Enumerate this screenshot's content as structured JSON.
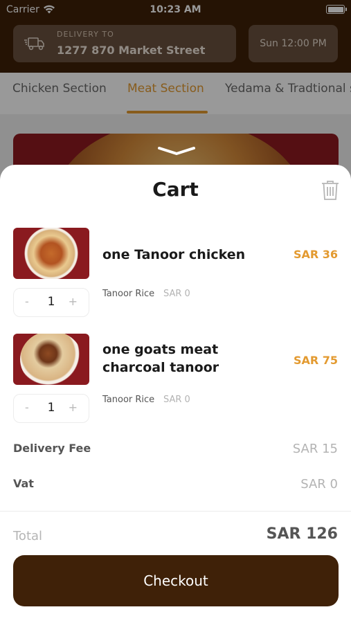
{
  "status_bar": {
    "carrier": "Carrier",
    "time": "10:23 AM"
  },
  "header": {
    "delivery_label": "DELIVERY TO",
    "delivery_address": "1277 870 Market Street",
    "delivery_time": "Sun 12:00 PM"
  },
  "tabs": [
    {
      "label": "Chicken Section",
      "active": false
    },
    {
      "label": "Meat Section",
      "active": true
    },
    {
      "label": "Yedama & Tradtional s",
      "active": false
    }
  ],
  "cart": {
    "title": "Cart",
    "items": [
      {
        "name": "one Tanoor chicken",
        "price": "SAR 36",
        "quantity": "1",
        "minus": "-",
        "plus": "+",
        "option_name": "Tanoor Rice",
        "option_price": "SAR 0"
      },
      {
        "name": "one goats meat charcoal tanoor",
        "price": "SAR 75",
        "quantity": "1",
        "minus": "-",
        "plus": "+",
        "option_name": "Tanoor Rice",
        "option_price": "SAR 0"
      }
    ],
    "delivery_fee_label": "Delivery Fee",
    "delivery_fee_value": "SAR 15",
    "vat_label": "Vat",
    "vat_value": "SAR 0",
    "total_label": "Total",
    "total_value": "SAR 126",
    "checkout_label": "Checkout"
  },
  "colors": {
    "brand_brown": "#3f2108",
    "accent_orange": "#e39a30",
    "muted_gray": "#b3b3b3"
  },
  "icons": [
    "wifi-icon",
    "battery-icon",
    "truck-icon",
    "trash-icon",
    "chevron-down-icon"
  ]
}
